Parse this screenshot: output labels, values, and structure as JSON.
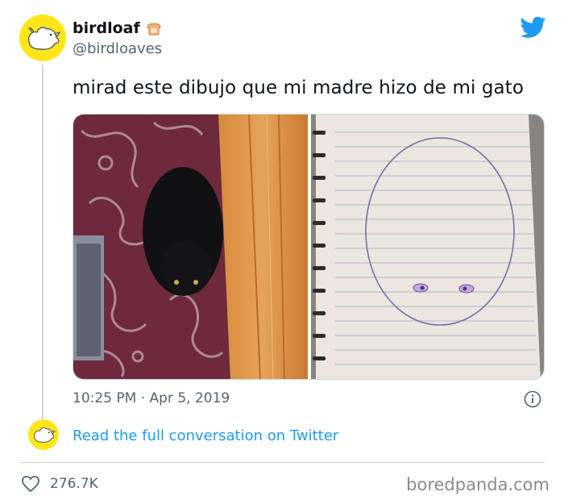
{
  "author": {
    "display_name": "birdloaf",
    "handle": "@birdloaves",
    "badge_icon": "bread-emoji-icon",
    "avatar_color": "#ffe61b"
  },
  "tweet": {
    "text": "mirad este dibujo que mi madre hizo de mi gato",
    "timestamp": "10:25 PM · Apr 5, 2019",
    "media": [
      {
        "description_icon": "cat-photo"
      },
      {
        "description_icon": "cat-drawing-photo"
      }
    ]
  },
  "actions": {
    "read_full_conversation": "Read the full conversation on Twitter",
    "like_count": "276.7K"
  },
  "colors": {
    "link": "#1d9bf0",
    "secondary_text": "#536471",
    "twitter_blue": "#1d9bf0"
  },
  "watermark": "boredpanda.com"
}
